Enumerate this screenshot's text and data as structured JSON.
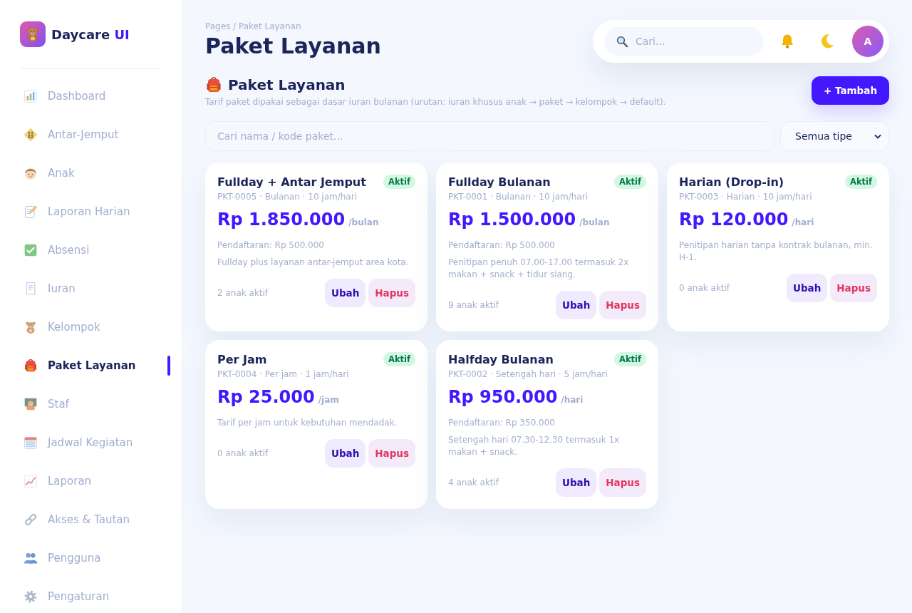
{
  "sidebar": {
    "brand": {
      "name": "Daycare",
      "accent": "UI"
    },
    "items": [
      {
        "label": "Dashboard",
        "selected": false
      },
      {
        "label": "Antar-Jemput",
        "selected": false
      },
      {
        "label": "Anak",
        "selected": false
      },
      {
        "label": "Laporan Harian",
        "selected": false
      },
      {
        "label": "Absensi",
        "selected": false
      },
      {
        "label": "Iuran",
        "selected": false
      },
      {
        "label": "Kelompok",
        "selected": false
      },
      {
        "label": "Paket Layanan",
        "selected": true
      },
      {
        "label": "Staf",
        "selected": false
      },
      {
        "label": "Jadwal Kegiatan",
        "selected": false
      },
      {
        "label": "Laporan",
        "selected": false
      },
      {
        "label": "Akses & Tautan",
        "selected": false
      },
      {
        "label": "Pengguna",
        "selected": false
      },
      {
        "label": "Pengaturan",
        "selected": false
      }
    ]
  },
  "header": {
    "breadcrumb": "Pages / Paket Layanan",
    "title": "Paket Layanan",
    "search": {
      "placeholder": "Cari..."
    },
    "avatar": "A"
  },
  "section": {
    "title": "Paket Layanan",
    "subtitle": "Tarif paket dipakai sebagai dasar iuran bulanan (urutan: iuran khusus anak → paket → kelompok → default).",
    "add_button": "+ Tambah"
  },
  "filters": {
    "search": {
      "placeholder": "Cari nama / kode paket..."
    },
    "type_select": "Semua tipe"
  },
  "packages": [
    {
      "name": "Fullday + Antar Jemput",
      "status": "Aktif",
      "meta": "PKT-0005 · Bulanan · 10 jam/hari",
      "price": "Rp 1.850.000",
      "unit": "/bulan",
      "registration": "Pendaftaran: Rp 500.000",
      "description": "Fullday plus layanan antar-jemput area kota.",
      "active_children": "2 anak aktif",
      "actions": [
        {
          "label": "Ubah",
          "kind": "edit"
        },
        {
          "label": "Hapus",
          "kind": "delete"
        }
      ]
    },
    {
      "name": "Fullday Bulanan",
      "status": "Aktif",
      "meta": "PKT-0001 · Bulanan · 10 jam/hari",
      "price": "Rp 1.500.000",
      "unit": "/bulan",
      "registration": "Pendaftaran: Rp 500.000",
      "description": "Penitipan penuh 07.00-17.00 termasuk 2x makan + snack + tidur siang.",
      "active_children": "9 anak aktif",
      "actions": [
        {
          "label": "Ubah",
          "kind": "edit"
        },
        {
          "label": "Hapus",
          "kind": "delete"
        }
      ]
    },
    {
      "name": "Harian (Drop-in)",
      "status": "Aktif",
      "meta": "PKT-0003 · Harian · 10 jam/hari",
      "price": "Rp 120.000",
      "unit": "/hari",
      "description": "Penitipan harian tanpa kontrak bulanan, min. H-1.",
      "active_children": "0 anak aktif",
      "actions": [
        {
          "label": "Ubah",
          "kind": "edit"
        },
        {
          "label": "Hapus",
          "kind": "delete"
        }
      ]
    },
    {
      "name": "Per Jam",
      "status": "Aktif",
      "meta": "PKT-0004 · Per jam · 1 jam/hari",
      "price": "Rp 25.000",
      "unit": "/jam",
      "description": "Tarif per jam untuk kebutuhan mendadak.",
      "active_children": "0 anak aktif",
      "actions": [
        {
          "label": "Ubah",
          "kind": "edit"
        },
        {
          "label": "Hapus",
          "kind": "delete"
        }
      ]
    },
    {
      "name": "Halfday Bulanan",
      "status": "Aktif",
      "meta": "PKT-0002 · Setengah hari · 5 jam/hari",
      "price": "Rp 950.000",
      "unit": "/hari",
      "registration": "Pendaftaran: Rp 350.000",
      "description": "Setengah hari 07.30-12.30 termasuk 1x makan + snack.",
      "active_children": "4 anak aktif",
      "actions": [
        {
          "label": "Ubah",
          "kind": "edit"
        },
        {
          "label": "Hapus",
          "kind": "delete"
        }
      ]
    }
  ]
}
